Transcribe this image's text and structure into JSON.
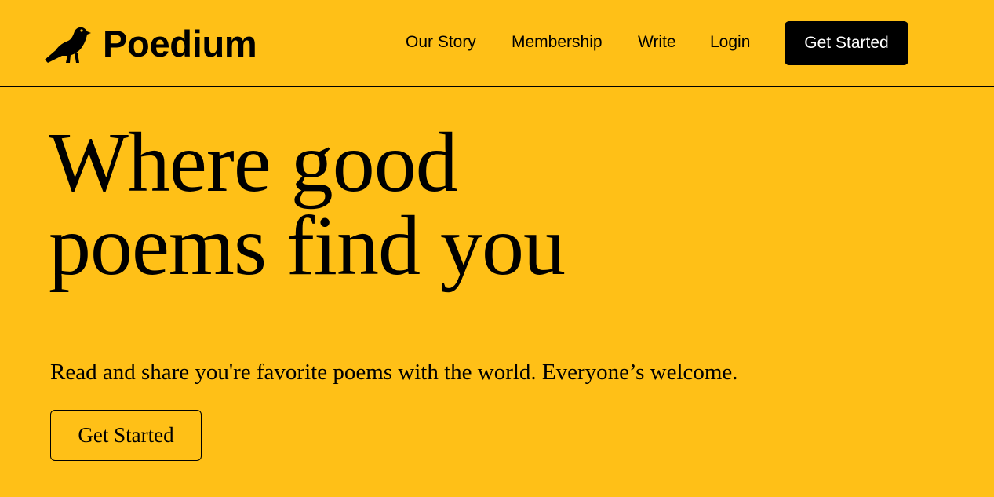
{
  "header": {
    "brand_name": "Poedium",
    "logo_icon": "crow-icon",
    "nav": [
      {
        "label": "Our Story"
      },
      {
        "label": "Membership"
      },
      {
        "label": "Write"
      },
      {
        "label": "Login"
      }
    ],
    "cta_label": "Get Started"
  },
  "hero": {
    "title_line1": "Where good",
    "title_line2": "poems find you",
    "subtitle": "Read and share you're favorite poems with the world. Everyone’s welcome.",
    "cta_label": "Get Started"
  },
  "colors": {
    "background": "#FFC017",
    "text": "#000000",
    "button_bg": "#000000",
    "button_text": "#FFFFFF"
  }
}
